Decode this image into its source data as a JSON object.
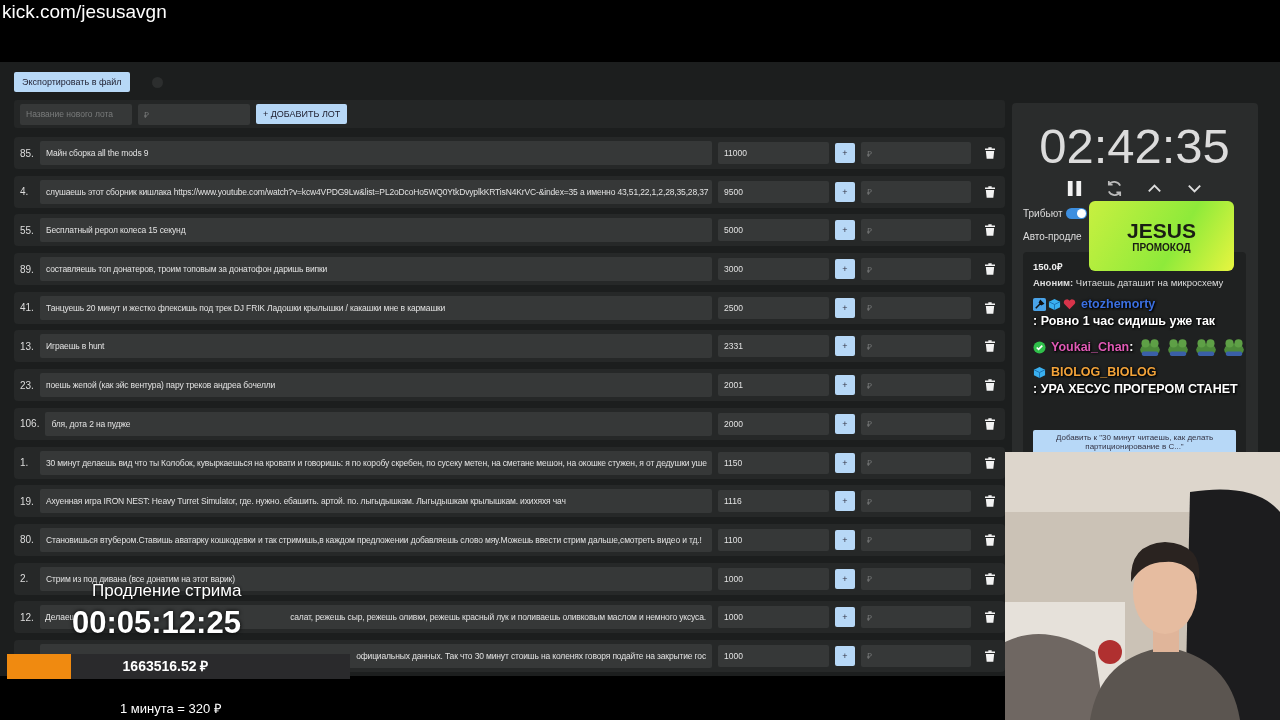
{
  "stream_url": "kick.com/jesusavgn",
  "toolbar": {
    "export_button": "Экспортировать в файл"
  },
  "new_lot": {
    "name_placeholder": "Название нового лота",
    "amount_placeholder": "₽",
    "add_button": "+ ДОБАВИТЬ ЛОТ"
  },
  "lots": [
    {
      "kind": "full",
      "number": "85.",
      "name": "Майн сборка all the mods 9",
      "amount": "11000",
      "add": "+",
      "bid_placeholder": "₽"
    },
    {
      "kind": "full",
      "number": "4.",
      "name": "слушаешь этот сборник кишлака https://www.youtube.com/watch?v=kcw4VPDG9Lw&list=PL2oDcoHo5WQ0YtkDvyplkKRTisN4KrVC-&index=35 а именно 43,51,22,1,2,28,35,28,37",
      "amount": "9500",
      "add": "+",
      "bid_placeholder": "₽"
    },
    {
      "kind": "full",
      "number": "55.",
      "name": "Бесплатный рерол колеса 15 секунд",
      "amount": "5000",
      "add": "+",
      "bid_placeholder": "₽"
    },
    {
      "kind": "full",
      "number": "89.",
      "name": "составляешь топ донатеров, троим топовым за донатофон даришь випки",
      "amount": "3000",
      "add": "+",
      "bid_placeholder": "₽"
    },
    {
      "kind": "full",
      "number": "41.",
      "name": "Танцуешь 20 минут и жестко флексишь под трек DJ FRIK Ладошки крылышки / какашки мне в кармашки",
      "amount": "2500",
      "add": "+",
      "bid_placeholder": "₽"
    },
    {
      "kind": "full",
      "number": "13.",
      "name": "Играешь в hunt",
      "amount": "2331",
      "add": "+",
      "bid_placeholder": "₽"
    },
    {
      "kind": "full",
      "number": "23.",
      "name": "поешь жепой (как эйс вентура) пару треков андреа бочелли",
      "amount": "2001",
      "add": "+",
      "bid_placeholder": "₽"
    },
    {
      "kind": "full",
      "number": "106.",
      "name": "бля, дота 2 на пудже",
      "amount": "2000",
      "add": "+",
      "bid_placeholder": "₽"
    },
    {
      "kind": "full",
      "number": "1.",
      "name": "30 минут делаешь вид что ты Колобок, кувыркаешься на кровати и говоришь: я по коробу скребен, по сусеку метен, на сметане мешон, на окошке стужен, я от дедушки уше",
      "amount": "1150",
      "add": "+",
      "bid_placeholder": "₽"
    },
    {
      "kind": "full",
      "number": "19.",
      "name": "Ахуенная игра IRON NEST: Heavy Turret Simulator, где. нужно. ебашить. артой. по. лыгыдышкам. Лыгыдышкам крылышкам. ихихяхя чач",
      "amount": "1116",
      "add": "+",
      "bid_placeholder": "₽"
    },
    {
      "kind": "full",
      "number": "80.",
      "name": "Становишься втубером.Ставишь аватарку кошкодевки и так стримишь,в каждом предложении добавляешь слово мяу.Можешь ввести стрим дальше,смотреть видео и тд.!",
      "amount": "1100",
      "add": "+",
      "bid_placeholder": "₽"
    },
    {
      "kind": "full",
      "number": "2.",
      "name": "Стрим из под дивана (все донатим на этот варик)",
      "amount": "1000",
      "add": "+",
      "bid_placeholder": "₽"
    },
    {
      "kind": "partial",
      "number": "12.",
      "name_start": "Делаеш",
      "name": "салат, режешь сыр, режешь оливки, режешь красный лук и поливаешь оливковым маслом и немного уксуса.",
      "amount": "1000",
      "add": "+",
      "bid_placeholder": "₽"
    },
    {
      "kind": "partial",
      "name": "официальных данных. Так что 30 минут стоишь на коленях говоря подайте на закрытие гос",
      "amount": "1000",
      "add": "+",
      "bid_placeholder": "₽"
    }
  ],
  "timer_panel": {
    "time": "02:42:35",
    "tribute": {
      "label": "Трибьют",
      "on": true
    },
    "auto_extend_label": "Авто-продле",
    "donation": {
      "amount": "150.0₽",
      "author": "Аноним:",
      "text": "Читаешь даташит на микросхему"
    },
    "add_button": "Добавить к \"30 минут читаешь, как делать партиционирование в С...\""
  },
  "promo": {
    "title": "JESUS",
    "subtitle": "ПРОМОКОД"
  },
  "chat": [
    {
      "user": "etozhemorty",
      "color": "#3b6fe0",
      "badges": [
        {
          "kind": "wrench"
        },
        {
          "kind": "cube"
        },
        {
          "kind": "heart"
        }
      ],
      "text": ": Ровно 1 час сидишь уже так"
    },
    {
      "user": "Youkai_Chan",
      "color": "#e05ab5",
      "badges": [
        {
          "kind": "check"
        }
      ],
      "text": ":",
      "emotes": [
        {
          "kind": "frog"
        },
        {
          "kind": "frog"
        },
        {
          "kind": "frog"
        },
        {
          "kind": "frog"
        }
      ]
    },
    {
      "user": "BIOLOG_BIOLOG",
      "color": "#f2a33a",
      "badges": [
        {
          "kind": "cube"
        }
      ],
      "text": ": УРА ХЕСУС ПРОГЕРОМ СТАНЕТ"
    }
  ],
  "extension": {
    "label": "Продление стрима",
    "time": "00:05:12:25"
  },
  "total": {
    "amount": "1663516.52 ₽"
  },
  "rate": "1 минута = 320 ₽"
}
